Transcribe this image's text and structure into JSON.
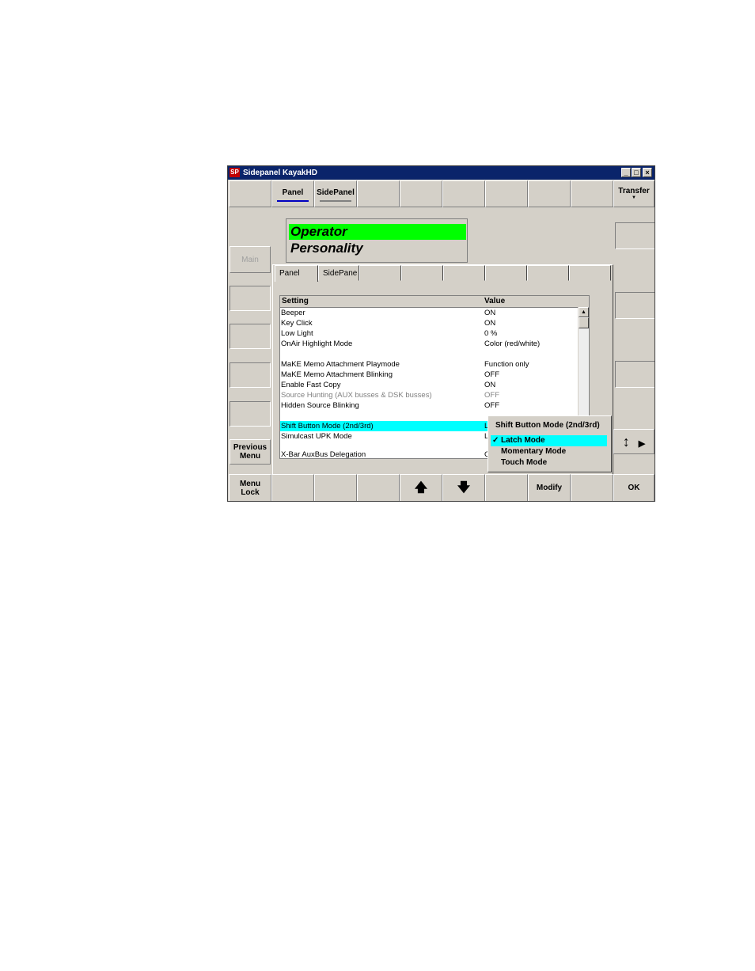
{
  "window": {
    "app_icon": "SP",
    "title": "Sidepanel KayakHD",
    "controls": {
      "minimize": "_",
      "maximize": "□",
      "close": "×"
    }
  },
  "top_bar": {
    "tabs": [
      {
        "label": "Panel",
        "underline": "#0000c0"
      },
      {
        "label": "SidePanel",
        "underline": "#808080"
      }
    ],
    "transfer_label": "Transfer",
    "transfer_caret": "▼"
  },
  "header": {
    "line1": "Operator",
    "line2": "Personality",
    "highlight_color": "#00ff00"
  },
  "left_menu": {
    "main_label": "Main",
    "previous_menu": [
      "Previous",
      "Menu"
    ]
  },
  "dialog": {
    "tabs": [
      "Panel",
      "SidePane"
    ],
    "columns": {
      "setting": "Setting",
      "value": "Value"
    },
    "rows": [
      {
        "setting": "Beeper",
        "value": "ON"
      },
      {
        "setting": "Key Click",
        "value": "ON"
      },
      {
        "setting": "Low Light",
        "value": "0 %"
      },
      {
        "setting": "OnAir Highlight Mode",
        "value": "Color (red/white)"
      },
      {
        "setting": "",
        "value": ""
      },
      {
        "setting": "MaKE Memo Attachment Playmode",
        "value": "Function only"
      },
      {
        "setting": "MaKE Memo Attachment Blinking",
        "value": "OFF"
      },
      {
        "setting": "Enable Fast Copy",
        "value": "ON"
      },
      {
        "setting": "Source Hunting (AUX busses & DSK busses)",
        "value": "OFF"
      },
      {
        "setting": "Hidden Source Blinking",
        "value": "OFF"
      },
      {
        "setting": "",
        "value": ""
      },
      {
        "setting": "Shift Button Mode (2nd/3rd)",
        "value": "L"
      },
      {
        "setting": "Simulcast UPK Mode",
        "value": "L"
      },
      {
        "setting": "",
        "value": ""
      },
      {
        "setting": "X-Bar AuxBus Delegation",
        "value": "C"
      }
    ],
    "selected_row_color": "#00ffff",
    "disabled_text_color": "#808080"
  },
  "dropdown": {
    "title": "Shift Button Mode (2nd/3rd)",
    "check": "✓",
    "items": [
      "Latch Mode",
      "Momentary Mode",
      "Touch Mode"
    ],
    "selected_color": "#00ffff"
  },
  "right_side": {
    "updown_icon": "↕",
    "arrow_icon": "▶"
  },
  "bottom_bar": {
    "menu_lock": [
      "Menu",
      "Lock"
    ],
    "up_arrow": "🡅",
    "down_arrow": "🡇",
    "modify_label": "Modify",
    "ok_label": "OK"
  }
}
